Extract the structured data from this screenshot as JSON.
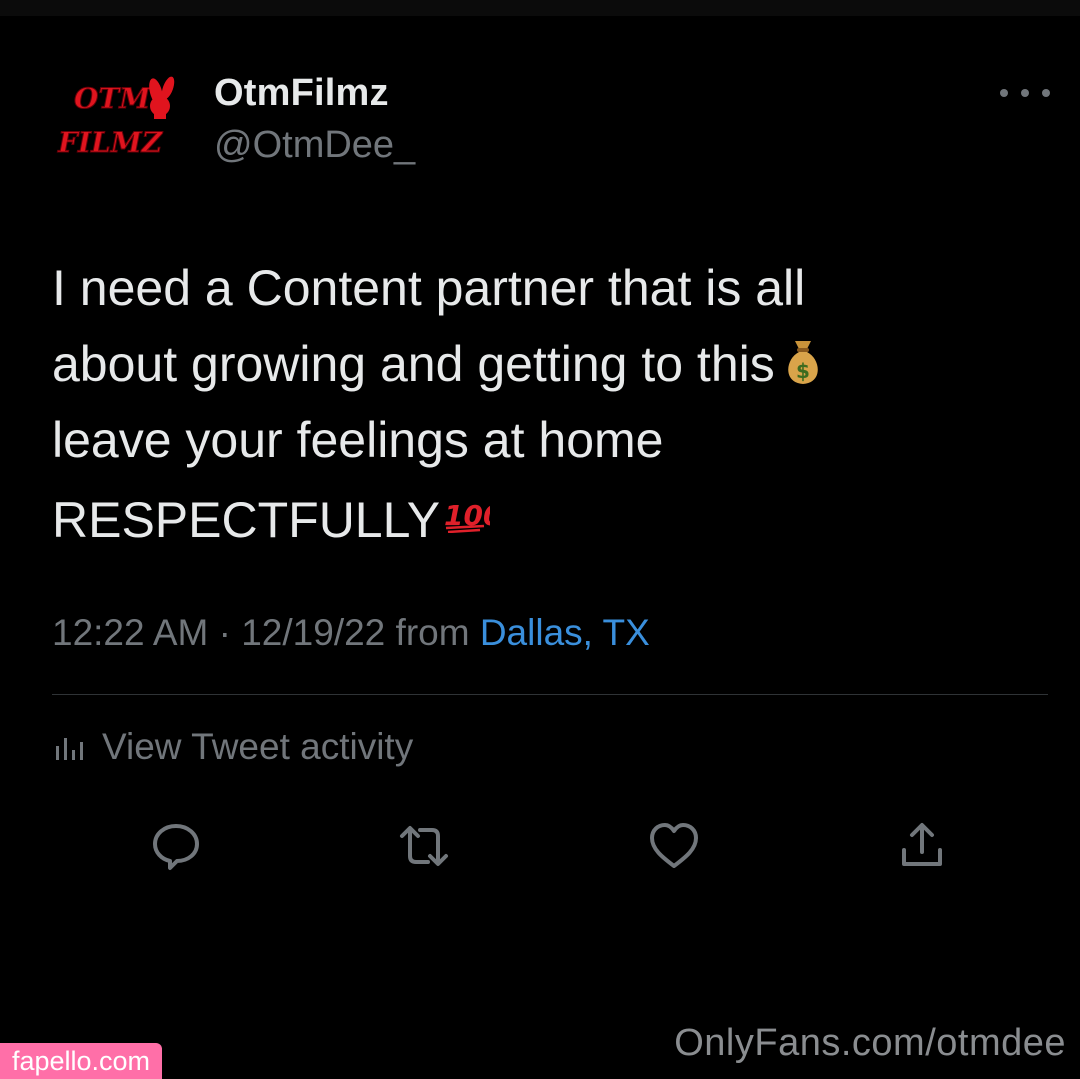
{
  "tweet": {
    "avatar_text_line1": "OTM",
    "avatar_text_line2": "FILMZ",
    "display_name": "OtmFilmz",
    "handle": "@OtmDee_",
    "text_lines": [
      "I need a Content partner that is all",
      "about growing and getting to this",
      "leave your feelings at home",
      "RESPECTFULLY"
    ],
    "emoji_money_bag": "money-bag",
    "emoji_hundred": "hundred-points",
    "time": "12:22 AM",
    "separator": " · ",
    "date": "12/19/22",
    "from_label": " from ",
    "location": "Dallas, TX",
    "activity_label": "View Tweet activity"
  },
  "actions": {
    "icons": [
      "reply-icon",
      "retweet-icon",
      "like-icon",
      "share-icon"
    ]
  },
  "watermarks": {
    "onlyfans": "OnlyFans.com/otmdee",
    "fapello": "fapello.com"
  },
  "colors": {
    "background": "#000000",
    "text_primary": "#e7e9ea",
    "text_secondary": "#71767b",
    "link": "#3a8fdc",
    "avatar_red": "#e0141e",
    "badge_pink": "#ff6fa8"
  }
}
